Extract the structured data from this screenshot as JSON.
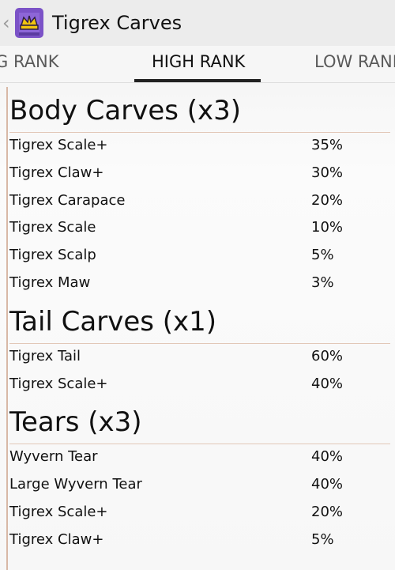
{
  "app": {
    "title": "Tigrex Carves",
    "back_icon": "chevron-left-icon",
    "app_icon": "crown-book-icon"
  },
  "tabs": {
    "left_partial": "G RANK",
    "active": "HIGH RANK",
    "right_partial": "LOW RANK"
  },
  "sections": [
    {
      "title": "Body Carves (x3)",
      "items": [
        {
          "name": "Tigrex Scale+",
          "pct": "35%"
        },
        {
          "name": "Tigrex Claw+",
          "pct": "30%"
        },
        {
          "name": "Tigrex Carapace",
          "pct": "20%"
        },
        {
          "name": "Tigrex Scale",
          "pct": "10%"
        },
        {
          "name": "Tigrex Scalp",
          "pct": "5%"
        },
        {
          "name": "Tigrex Maw",
          "pct": "3%"
        }
      ]
    },
    {
      "title": "Tail Carves (x1)",
      "items": [
        {
          "name": "Tigrex Tail",
          "pct": "60%"
        },
        {
          "name": "Tigrex Scale+",
          "pct": "40%"
        }
      ]
    },
    {
      "title": "Tears (x3)",
      "items": [
        {
          "name": "Wyvern Tear",
          "pct": "40%"
        },
        {
          "name": "Large Wyvern Tear",
          "pct": "40%"
        },
        {
          "name": "Tigrex Scale+",
          "pct": "20%"
        },
        {
          "name": "Tigrex Claw+",
          "pct": "5%"
        }
      ]
    }
  ]
}
